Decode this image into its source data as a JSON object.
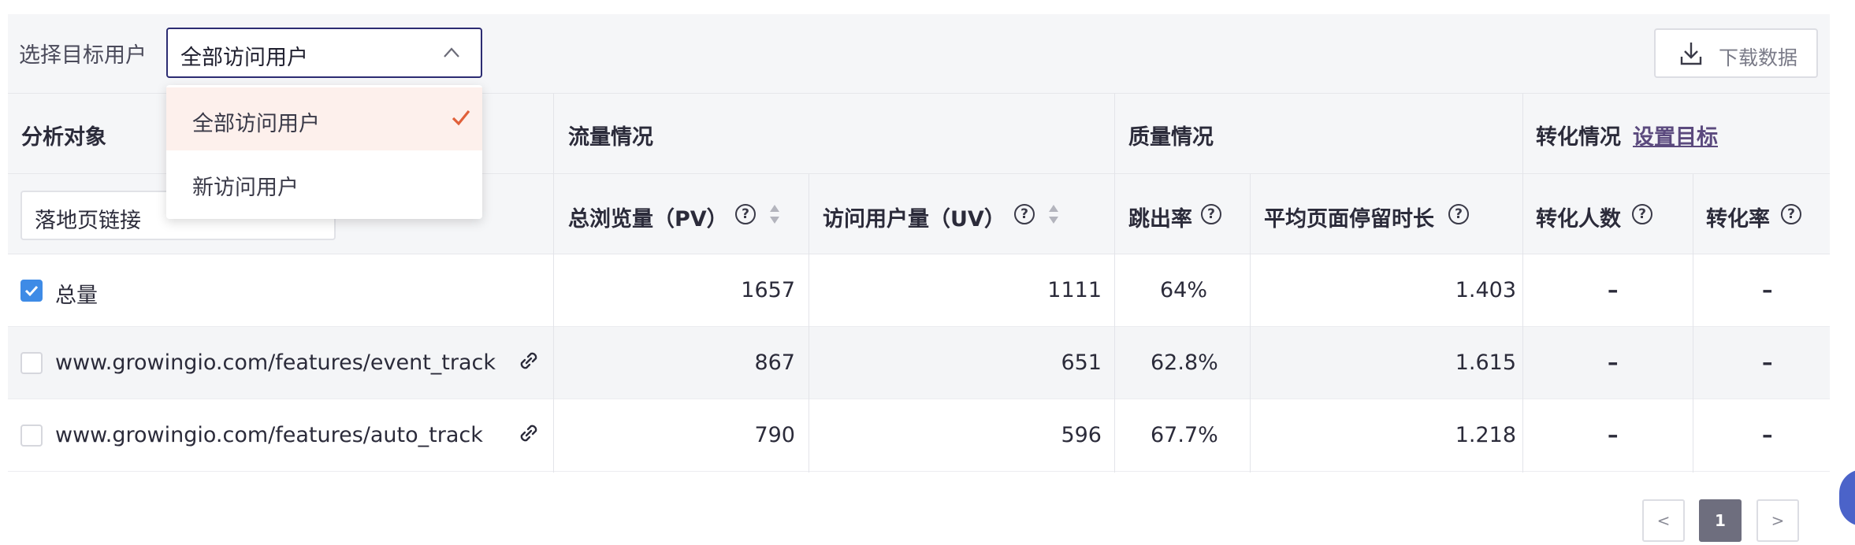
{
  "filter": {
    "label": "选择目标用户",
    "selected": "全部访问用户",
    "options": [
      "全部访问用户",
      "新访问用户"
    ]
  },
  "download": {
    "label": "下载数据"
  },
  "groups": {
    "object": "分析对象",
    "traffic": "流量情况",
    "quality": "质量情况",
    "conversion": "转化情况",
    "set_goal": "设置目标"
  },
  "columns": {
    "dimension": "落地页链接",
    "pv": "总浏览量（PV）",
    "uv": "访问用户量（UV）",
    "bounce": "跳出率",
    "avg_time": "平均页面停留时长",
    "conv_users": "转化人数",
    "conv_rate": "转化率",
    "help_glyph": "?"
  },
  "rows": [
    {
      "name": "总量",
      "pv": "1657",
      "uv": "1111",
      "bounce": "64%",
      "avg_time": "1.403",
      "conv_users": "–",
      "conv_rate": "–",
      "checked": true
    },
    {
      "name": "www.growingio.com/features/event_track",
      "pv": "867",
      "uv": "651",
      "bounce": "62.8%",
      "avg_time": "1.615",
      "conv_users": "–",
      "conv_rate": "–",
      "checked": false
    },
    {
      "name": "www.growingio.com/features/auto_track",
      "pv": "790",
      "uv": "596",
      "bounce": "67.7%",
      "avg_time": "1.218",
      "conv_users": "–",
      "conv_rate": "–",
      "checked": false
    }
  ],
  "pagination": {
    "prev": "<",
    "current": "1",
    "next": ">"
  },
  "colors": {
    "accent": "#2c2c72",
    "checkbox": "#3e8be6",
    "dropdown_check": "#e0603a",
    "link": "#5b4a7e"
  }
}
